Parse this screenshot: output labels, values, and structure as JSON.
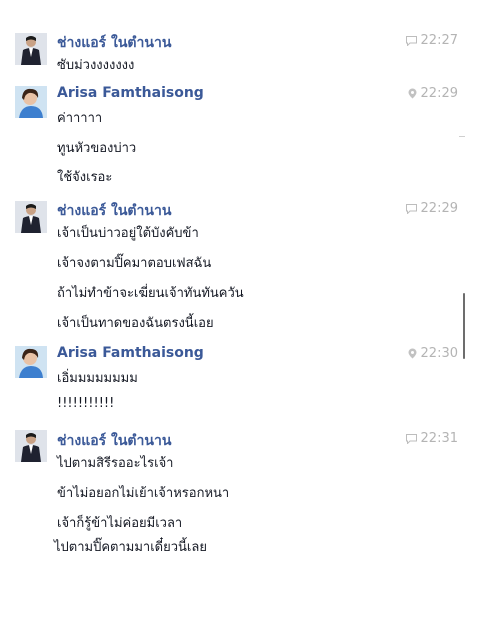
{
  "conversation": {
    "groups": [
      {
        "sender": "ช่างแอร์ ในตำนาน",
        "time": "22:27",
        "meta_icon": "chat-bubble-icon",
        "avatar": "man-in-suit-avatar",
        "messages": [
          "ซับม่วงงงงงงง"
        ]
      },
      {
        "sender": "Arisa Famthaisong",
        "time": "22:29",
        "meta_icon": "location-pin-icon",
        "avatar": "woman-avatar",
        "messages": [
          "ค่าาาาา",
          "ทูนหัวของบ่าว",
          "ใช้จังเรอะ"
        ]
      },
      {
        "sender": "ช่างแอร์ ในตำนาน",
        "time": "22:29",
        "meta_icon": "chat-bubble-icon",
        "avatar": "man-in-suit-avatar",
        "messages": [
          "เจ้าเป็นบ่าวอยู่ใต้บังคับข้า",
          "เจ้าจงตามปิ๊คมาตอบเฟสฉัน",
          "ถ้าไม่ทำข้าจะเฆี่ยนเจ้าทันทันควัน",
          "เจ้าเป็นทาดของฉันตรงนี้เอย"
        ]
      },
      {
        "sender": "Arisa Famthaisong",
        "time": "22:30",
        "meta_icon": "location-pin-icon",
        "avatar": "woman-avatar",
        "messages": [
          "เอิ่มมมมมมมม",
          "!!!!!!!!!!!"
        ]
      },
      {
        "sender": "ช่างแอร์ ในตำนาน",
        "time": "22:31",
        "meta_icon": "chat-bubble-icon",
        "avatar": "man-in-suit-avatar",
        "messages": [
          "ไปตามสิรีรออะไรเจ้า",
          "ข้าไม่อยอกไม่เย้าเจ้าหรอกหนา",
          "เจ้าก็รู้ข้าไม่ค่อยมีเวลา",
          "ไปตามปิ๊คตามมาเดี๋ยวนี้เลย"
        ]
      }
    ]
  }
}
